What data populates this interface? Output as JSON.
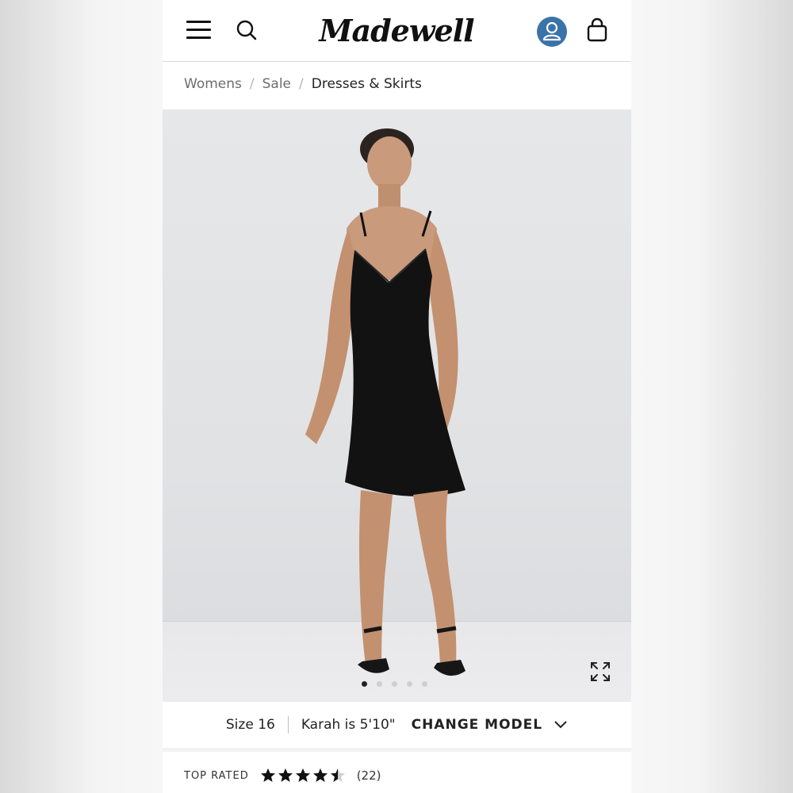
{
  "header": {
    "brand": "Madewell",
    "menu_icon": "hamburger-menu-icon",
    "search_icon": "search-icon",
    "account_icon": "user-account-icon",
    "bag_icon": "shopping-bag-icon",
    "account_color": "#3b73a8"
  },
  "breadcrumb": {
    "items": [
      "Womens",
      "Sale",
      "Dresses & Skirts"
    ],
    "separator": "/"
  },
  "gallery": {
    "image_count": 5,
    "active_index": 0,
    "expand_icon": "expand-icon"
  },
  "model_info": {
    "size": "Size 16",
    "height": "Karah is 5'10\"",
    "change_label": "CHANGE MODEL",
    "chevron_icon": "chevron-down-icon"
  },
  "rating": {
    "label": "TOP RATED",
    "stars": 4.5,
    "count": "(22)"
  }
}
